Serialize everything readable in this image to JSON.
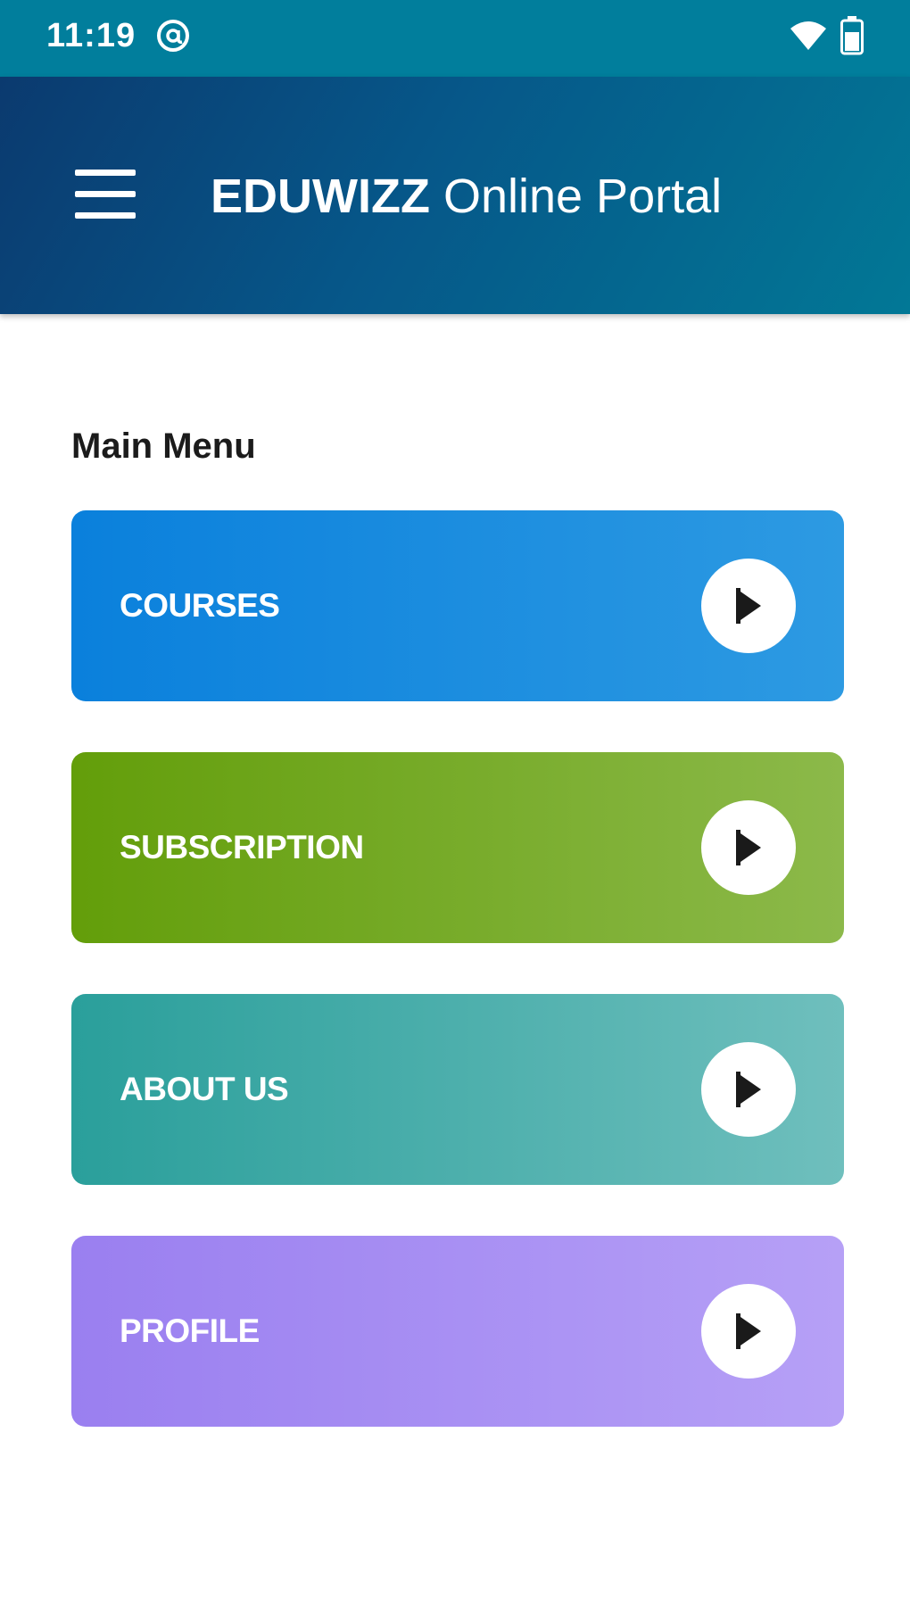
{
  "status_bar": {
    "time": "11:19",
    "icons": [
      "notification-icon",
      "wifi-icon",
      "battery-icon"
    ]
  },
  "app_bar": {
    "menu_icon": "hamburger-menu-icon",
    "title_brand": "EDUWIZZ",
    "title_rest": " Online Portal"
  },
  "main": {
    "section_label": "Main Menu",
    "items": [
      {
        "label": "COURSES",
        "icon": "play-icon",
        "color": "#0a80dc"
      },
      {
        "label": "SUBSCRIPTION",
        "icon": "play-icon",
        "color": "#639e0a"
      },
      {
        "label": "ABOUT US",
        "icon": "play-icon",
        "color": "#2a9f9b"
      },
      {
        "label": "PROFILE",
        "icon": "play-icon",
        "color": "#9a7ff0"
      }
    ]
  },
  "colors": {
    "status_bar": "#017e9c",
    "app_bar_start": "#0b3a6f",
    "app_bar_end": "#027896"
  }
}
